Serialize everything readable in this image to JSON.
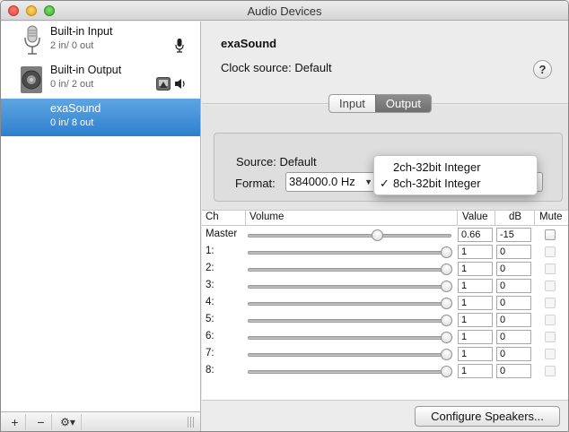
{
  "window": {
    "title": "Audio Devices"
  },
  "sidebar": {
    "devices": [
      {
        "name": "Built-in Input",
        "io": "2 in/ 0 out",
        "icon": "microphone-icon",
        "selected": false
      },
      {
        "name": "Built-in Output",
        "io": "0 in/ 2 out",
        "icon": "speaker-icon",
        "selected": false
      },
      {
        "name": "exaSound",
        "io": "0 in/ 8 out",
        "icon": "",
        "selected": true
      }
    ],
    "footer": {
      "add": "+",
      "remove": "−",
      "gear": "⚙▾"
    }
  },
  "detail": {
    "device_name": "exaSound",
    "clock_label": "Clock source:",
    "clock_value": "Default",
    "help": "?",
    "tabs": [
      "Input",
      "Output"
    ],
    "active_tab": "Output",
    "source_label": "Source:",
    "source_value": "Default",
    "format_label": "Format:",
    "format_rate": "384000.0 Hz",
    "format_options": [
      "2ch-32bit Integer",
      "8ch-32bit Integer"
    ],
    "format_selected": "8ch-32bit Integer"
  },
  "table": {
    "headers": {
      "ch": "Ch",
      "volume": "Volume",
      "value": "Value",
      "db": "dB",
      "mute": "Mute"
    },
    "rows": [
      {
        "ch": "Master",
        "value": "0.66",
        "db": "-15",
        "level": 0.66,
        "mute_enabled": true
      },
      {
        "ch": "1:",
        "value": "1",
        "db": "0",
        "level": 1,
        "mute_enabled": false
      },
      {
        "ch": "2:",
        "value": "1",
        "db": "0",
        "level": 1,
        "mute_enabled": false
      },
      {
        "ch": "3:",
        "value": "1",
        "db": "0",
        "level": 1,
        "mute_enabled": false
      },
      {
        "ch": "4:",
        "value": "1",
        "db": "0",
        "level": 1,
        "mute_enabled": false
      },
      {
        "ch": "5:",
        "value": "1",
        "db": "0",
        "level": 1,
        "mute_enabled": false
      },
      {
        "ch": "6:",
        "value": "1",
        "db": "0",
        "level": 1,
        "mute_enabled": false
      },
      {
        "ch": "7:",
        "value": "1",
        "db": "0",
        "level": 1,
        "mute_enabled": false
      },
      {
        "ch": "8:",
        "value": "1",
        "db": "0",
        "level": 1,
        "mute_enabled": false
      }
    ]
  },
  "buttons": {
    "configure": "Configure Speakers..."
  }
}
